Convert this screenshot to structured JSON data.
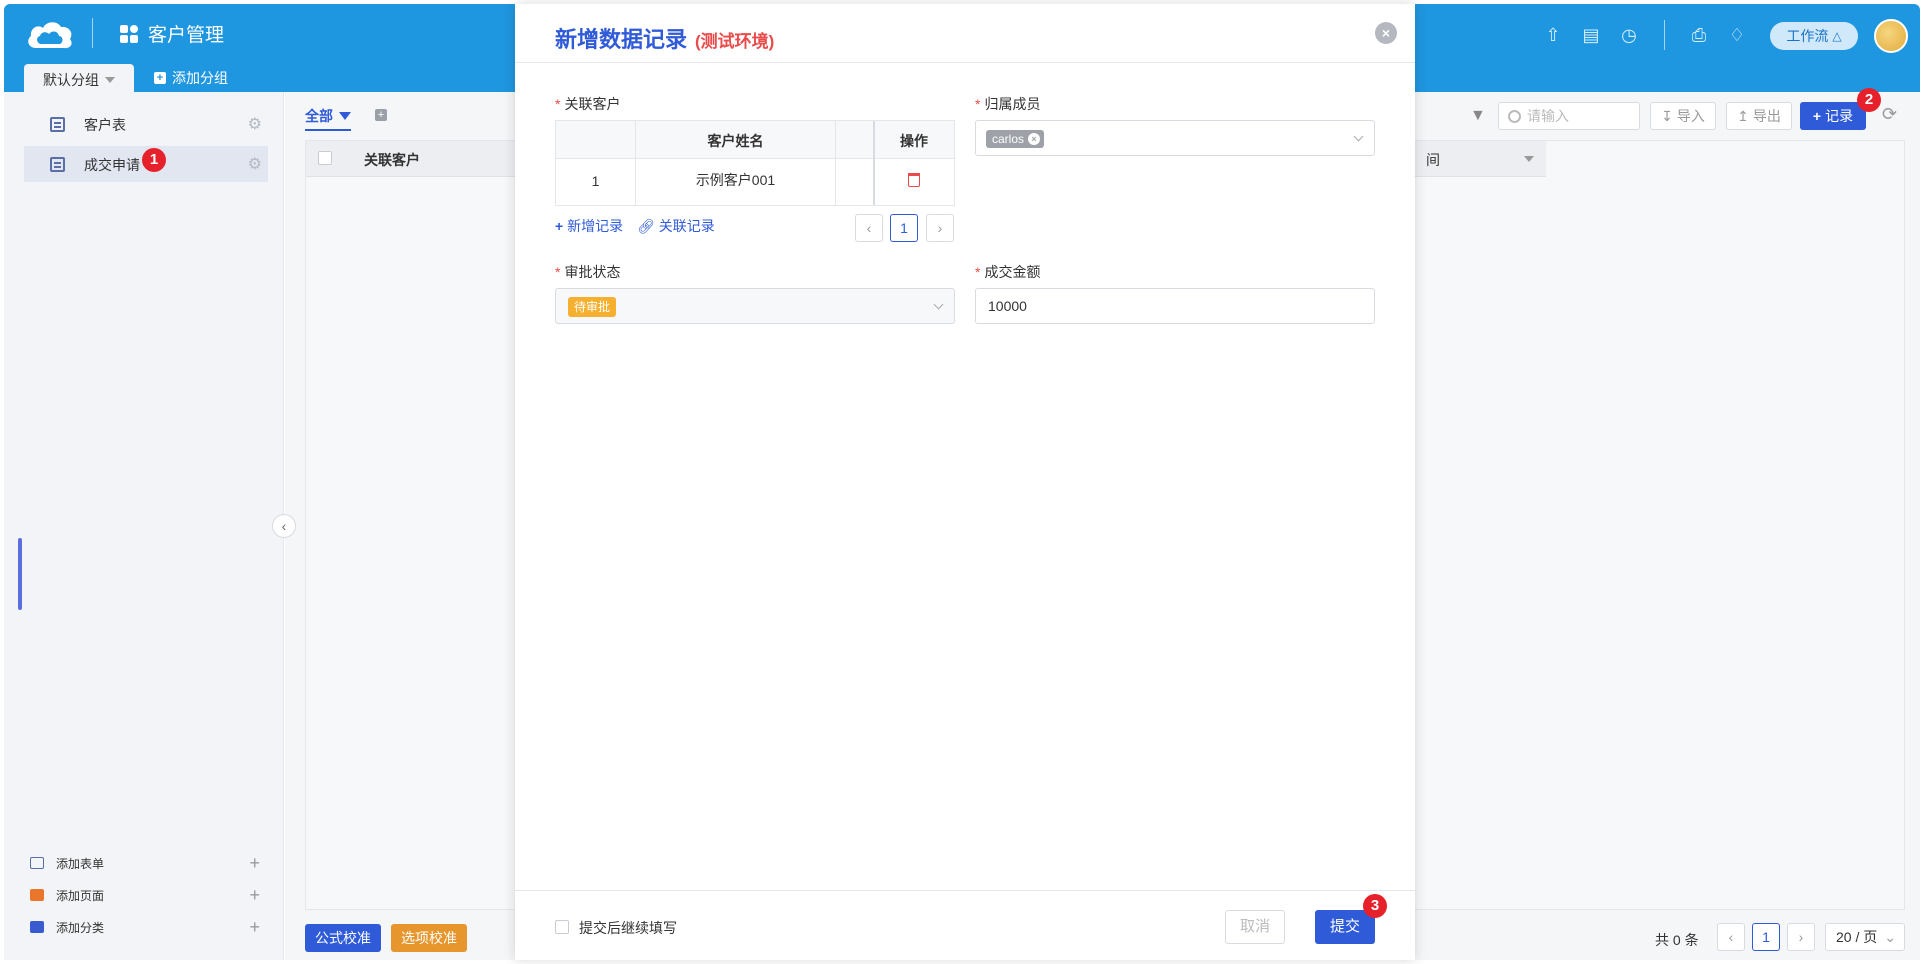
{
  "header": {
    "app_title": "客户管理",
    "workflow_label": "工作流",
    "icons": [
      "upload-icon",
      "document-icon",
      "clock-icon",
      "clipboard-icon",
      "bell-icon"
    ]
  },
  "groups": {
    "active": "默认分组",
    "add": "添加分组"
  },
  "sidebar": {
    "items": [
      {
        "label": "客户表"
      },
      {
        "label": "成交申请"
      }
    ],
    "bottom": [
      {
        "label": "添加表单"
      },
      {
        "label": "添加页面"
      },
      {
        "label": "添加分类"
      }
    ]
  },
  "main": {
    "view_tab": "全部",
    "column_1": "关联客户",
    "column_2_partial": "间",
    "search_placeholder": "请输入",
    "import_label": "导入",
    "export_label": "导出",
    "add_record_label": "记录",
    "formula_check": "公式校准",
    "option_check": "选项校准",
    "total": "共 0 条",
    "page": "1",
    "page_size": "20 / 页"
  },
  "modal": {
    "title": "新增数据记录",
    "env": "(测试环境)",
    "fields": {
      "related_customer": {
        "label": "关联客户",
        "col_name": "客户姓名",
        "col_action": "操作",
        "rows": [
          {
            "index": "1",
            "name": "示例客户001"
          }
        ],
        "add_record": "新增记录",
        "link_record": "关联记录",
        "page": "1"
      },
      "owner": {
        "label": "归属成员",
        "value": "carlos"
      },
      "approval_status": {
        "label": "审批状态",
        "value": "待审批"
      },
      "deal_amount": {
        "label": "成交金额",
        "value": "10000"
      }
    },
    "continue_label": "提交后继续填写",
    "cancel": "取消",
    "submit": "提交"
  },
  "badges": [
    "1",
    "2",
    "3"
  ],
  "colors": {
    "header_blue": "#1f96e0",
    "primary": "#2f5bd8",
    "danger": "#e94b4b",
    "warning": "#f5b02f",
    "badge_red": "#e7212b"
  }
}
